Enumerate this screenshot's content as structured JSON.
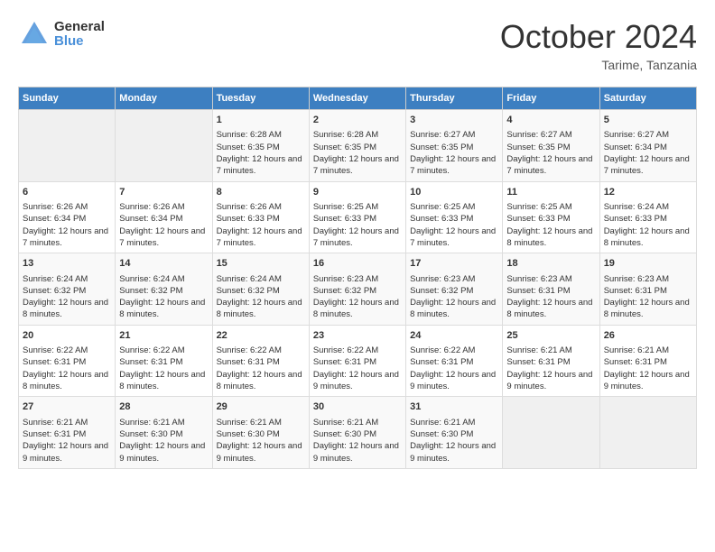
{
  "logo": {
    "general": "General",
    "blue": "Blue"
  },
  "header": {
    "month": "October 2024",
    "location": "Tarime, Tanzania"
  },
  "days_of_week": [
    "Sunday",
    "Monday",
    "Tuesday",
    "Wednesday",
    "Thursday",
    "Friday",
    "Saturday"
  ],
  "weeks": [
    [
      {
        "day": "",
        "info": ""
      },
      {
        "day": "",
        "info": ""
      },
      {
        "day": "1",
        "info": "Sunrise: 6:28 AM\nSunset: 6:35 PM\nDaylight: 12 hours and 7 minutes."
      },
      {
        "day": "2",
        "info": "Sunrise: 6:28 AM\nSunset: 6:35 PM\nDaylight: 12 hours and 7 minutes."
      },
      {
        "day": "3",
        "info": "Sunrise: 6:27 AM\nSunset: 6:35 PM\nDaylight: 12 hours and 7 minutes."
      },
      {
        "day": "4",
        "info": "Sunrise: 6:27 AM\nSunset: 6:35 PM\nDaylight: 12 hours and 7 minutes."
      },
      {
        "day": "5",
        "info": "Sunrise: 6:27 AM\nSunset: 6:34 PM\nDaylight: 12 hours and 7 minutes."
      }
    ],
    [
      {
        "day": "6",
        "info": "Sunrise: 6:26 AM\nSunset: 6:34 PM\nDaylight: 12 hours and 7 minutes."
      },
      {
        "day": "7",
        "info": "Sunrise: 6:26 AM\nSunset: 6:34 PM\nDaylight: 12 hours and 7 minutes."
      },
      {
        "day": "8",
        "info": "Sunrise: 6:26 AM\nSunset: 6:33 PM\nDaylight: 12 hours and 7 minutes."
      },
      {
        "day": "9",
        "info": "Sunrise: 6:25 AM\nSunset: 6:33 PM\nDaylight: 12 hours and 7 minutes."
      },
      {
        "day": "10",
        "info": "Sunrise: 6:25 AM\nSunset: 6:33 PM\nDaylight: 12 hours and 7 minutes."
      },
      {
        "day": "11",
        "info": "Sunrise: 6:25 AM\nSunset: 6:33 PM\nDaylight: 12 hours and 8 minutes."
      },
      {
        "day": "12",
        "info": "Sunrise: 6:24 AM\nSunset: 6:33 PM\nDaylight: 12 hours and 8 minutes."
      }
    ],
    [
      {
        "day": "13",
        "info": "Sunrise: 6:24 AM\nSunset: 6:32 PM\nDaylight: 12 hours and 8 minutes."
      },
      {
        "day": "14",
        "info": "Sunrise: 6:24 AM\nSunset: 6:32 PM\nDaylight: 12 hours and 8 minutes."
      },
      {
        "day": "15",
        "info": "Sunrise: 6:24 AM\nSunset: 6:32 PM\nDaylight: 12 hours and 8 minutes."
      },
      {
        "day": "16",
        "info": "Sunrise: 6:23 AM\nSunset: 6:32 PM\nDaylight: 12 hours and 8 minutes."
      },
      {
        "day": "17",
        "info": "Sunrise: 6:23 AM\nSunset: 6:32 PM\nDaylight: 12 hours and 8 minutes."
      },
      {
        "day": "18",
        "info": "Sunrise: 6:23 AM\nSunset: 6:31 PM\nDaylight: 12 hours and 8 minutes."
      },
      {
        "day": "19",
        "info": "Sunrise: 6:23 AM\nSunset: 6:31 PM\nDaylight: 12 hours and 8 minutes."
      }
    ],
    [
      {
        "day": "20",
        "info": "Sunrise: 6:22 AM\nSunset: 6:31 PM\nDaylight: 12 hours and 8 minutes."
      },
      {
        "day": "21",
        "info": "Sunrise: 6:22 AM\nSunset: 6:31 PM\nDaylight: 12 hours and 8 minutes."
      },
      {
        "day": "22",
        "info": "Sunrise: 6:22 AM\nSunset: 6:31 PM\nDaylight: 12 hours and 8 minutes."
      },
      {
        "day": "23",
        "info": "Sunrise: 6:22 AM\nSunset: 6:31 PM\nDaylight: 12 hours and 9 minutes."
      },
      {
        "day": "24",
        "info": "Sunrise: 6:22 AM\nSunset: 6:31 PM\nDaylight: 12 hours and 9 minutes."
      },
      {
        "day": "25",
        "info": "Sunrise: 6:21 AM\nSunset: 6:31 PM\nDaylight: 12 hours and 9 minutes."
      },
      {
        "day": "26",
        "info": "Sunrise: 6:21 AM\nSunset: 6:31 PM\nDaylight: 12 hours and 9 minutes."
      }
    ],
    [
      {
        "day": "27",
        "info": "Sunrise: 6:21 AM\nSunset: 6:31 PM\nDaylight: 12 hours and 9 minutes."
      },
      {
        "day": "28",
        "info": "Sunrise: 6:21 AM\nSunset: 6:30 PM\nDaylight: 12 hours and 9 minutes."
      },
      {
        "day": "29",
        "info": "Sunrise: 6:21 AM\nSunset: 6:30 PM\nDaylight: 12 hours and 9 minutes."
      },
      {
        "day": "30",
        "info": "Sunrise: 6:21 AM\nSunset: 6:30 PM\nDaylight: 12 hours and 9 minutes."
      },
      {
        "day": "31",
        "info": "Sunrise: 6:21 AM\nSunset: 6:30 PM\nDaylight: 12 hours and 9 minutes."
      },
      {
        "day": "",
        "info": ""
      },
      {
        "day": "",
        "info": ""
      }
    ]
  ]
}
